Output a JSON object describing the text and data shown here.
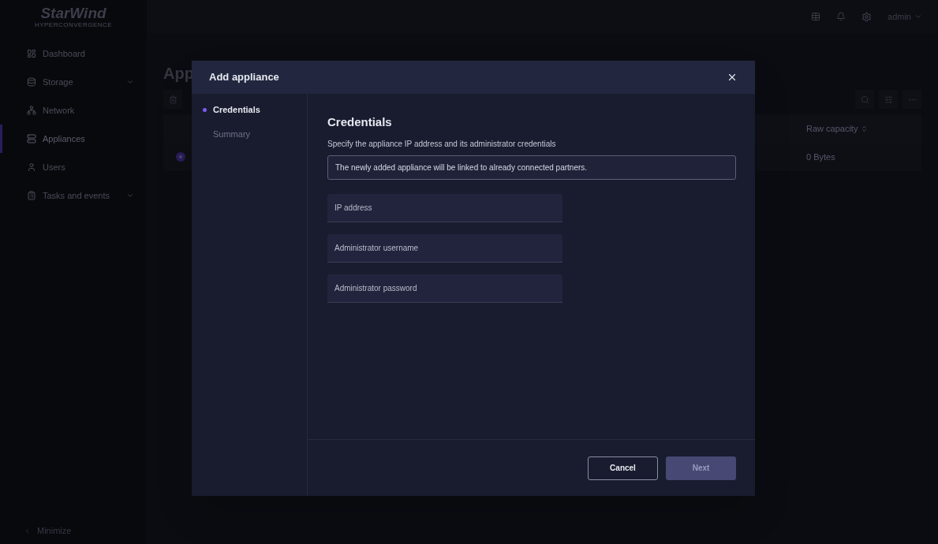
{
  "logo": {
    "name": "StarWind",
    "tagline": "HYPERCONVERGENCE"
  },
  "header": {
    "user": "admin"
  },
  "sidebar": {
    "items": [
      {
        "label": "Dashboard",
        "selected": false,
        "expandable": false
      },
      {
        "label": "Storage",
        "selected": false,
        "expandable": true
      },
      {
        "label": "Network",
        "selected": false,
        "expandable": false
      },
      {
        "label": "Appliances",
        "selected": true,
        "expandable": false
      },
      {
        "label": "Users",
        "selected": false,
        "expandable": false
      },
      {
        "label": "Tasks and events",
        "selected": false,
        "expandable": true
      }
    ],
    "minimize": "Minimize"
  },
  "page": {
    "title": "App",
    "table": {
      "columns": [
        "Raw capacity"
      ],
      "rows": [
        {
          "selected": true,
          "cells": [
            "0 Bytes"
          ]
        }
      ]
    }
  },
  "dialog": {
    "title": "Add appliance",
    "steps": [
      {
        "label": "Credentials",
        "selected": true
      },
      {
        "label": "Summary",
        "selected": false
      }
    ],
    "heading": "Credentials",
    "description": "Specify the appliance IP address and its administrator credentials",
    "notice": "The newly added appliance will be linked to already connected partners.",
    "fields": [
      {
        "placeholder": "IP address"
      },
      {
        "placeholder": "Administrator username"
      },
      {
        "placeholder": "Administrator password"
      }
    ],
    "buttons": [
      {
        "label": "Cancel",
        "kind": "secondary",
        "disabled": false
      },
      {
        "label": "Next",
        "kind": "primary",
        "disabled": true
      }
    ]
  }
}
